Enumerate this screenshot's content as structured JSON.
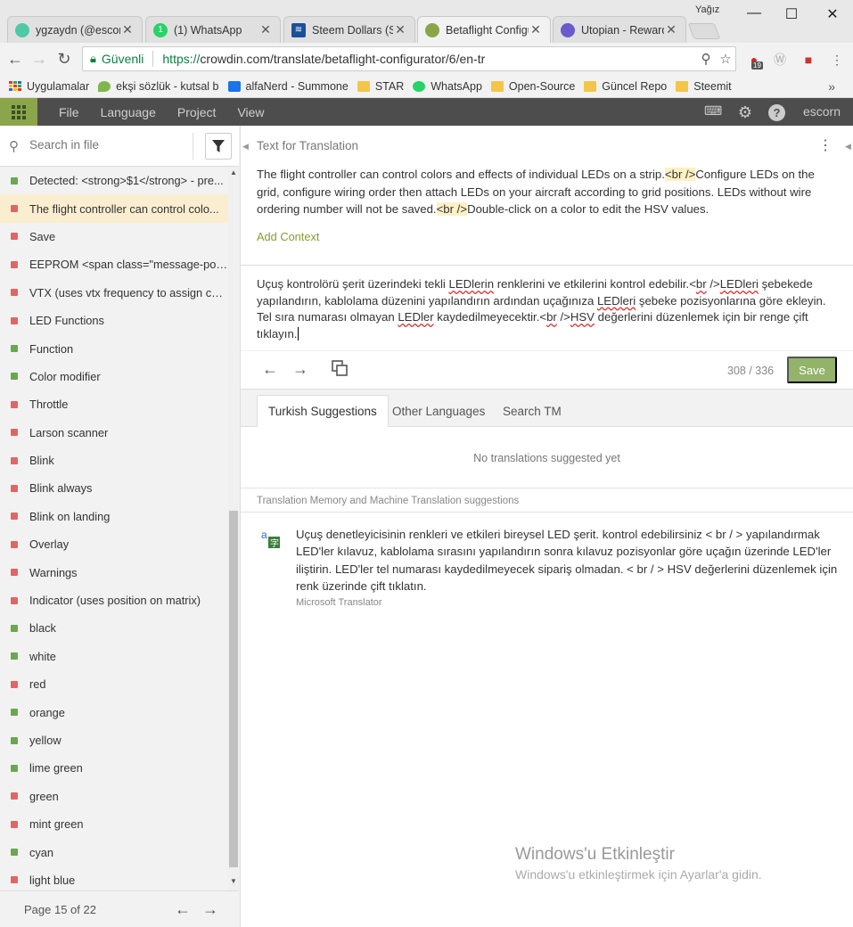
{
  "browser": {
    "profile_name": "Yağız",
    "tabs": [
      {
        "title": "ygzaydn (@escor",
        "icon": "steemit-favicon",
        "color": "#4ec9a8"
      },
      {
        "title": "(1) WhatsApp",
        "icon": "whatsapp-favicon",
        "color": "#25d366"
      },
      {
        "title": "Steem Dollars (SB",
        "icon": "steem-favicon",
        "color": "#1a5099"
      },
      {
        "title": "Betaflight Configu",
        "icon": "crowdin-favicon",
        "color": "#8aa54a"
      },
      {
        "title": "Utopian - Reward",
        "icon": "utopian-favicon",
        "color": "#6a5acd"
      }
    ],
    "address": {
      "secure_label": "Güvenli",
      "url_scheme": "https://",
      "url_rest": "crowdin.com/translate/betaflight-configurator/6/en-tr"
    },
    "extension_badge": "19",
    "bookmarks": [
      {
        "label": "Uygulamalar",
        "icon": "apps-grid-icon"
      },
      {
        "label": "ekşi sözlük - kutsal b",
        "icon": "eksi-drop-icon"
      },
      {
        "label": "alfaNerd - Summone",
        "icon": "alfanerd-icon"
      },
      {
        "label": "STAR",
        "icon": "folder-icon"
      },
      {
        "label": "WhatsApp",
        "icon": "whatsapp-icon"
      },
      {
        "label": "Open-Source",
        "icon": "folder-icon"
      },
      {
        "label": "Güncel Repo",
        "icon": "folder-icon"
      },
      {
        "label": "Steemit",
        "icon": "folder-icon"
      }
    ]
  },
  "app": {
    "menu": [
      "File",
      "Language",
      "Project",
      "View"
    ],
    "user": "escorn",
    "accent": "#8aa54a"
  },
  "sidebar": {
    "search_placeholder": "Search in file",
    "items": [
      {
        "label": "Detected: <strong>$1</strong> - pre...",
        "status": "translated"
      },
      {
        "label": "The flight controller can control colo...",
        "status": "untranslated",
        "selected": true
      },
      {
        "label": "Save",
        "status": "untranslated"
      },
      {
        "label": "EEPROM <span class=\"message-posi...",
        "status": "untranslated"
      },
      {
        "label": "VTX (uses vtx frequency to assign col...",
        "status": "untranslated"
      },
      {
        "label": "LED Functions",
        "status": "untranslated"
      },
      {
        "label": "Function",
        "status": "translated"
      },
      {
        "label": "Color modifier",
        "status": "translated"
      },
      {
        "label": "Throttle",
        "status": "untranslated"
      },
      {
        "label": "Larson scanner",
        "status": "untranslated"
      },
      {
        "label": "Blink",
        "status": "untranslated"
      },
      {
        "label": "Blink always",
        "status": "untranslated"
      },
      {
        "label": "Blink on landing",
        "status": "untranslated"
      },
      {
        "label": "Overlay",
        "status": "untranslated"
      },
      {
        "label": "Warnings",
        "status": "untranslated"
      },
      {
        "label": "Indicator (uses position on matrix)",
        "status": "untranslated"
      },
      {
        "label": "black",
        "status": "translated"
      },
      {
        "label": "white",
        "status": "translated"
      },
      {
        "label": "red",
        "status": "untranslated"
      },
      {
        "label": "orange",
        "status": "translated"
      },
      {
        "label": "yellow",
        "status": "translated"
      },
      {
        "label": "lime green",
        "status": "translated"
      },
      {
        "label": "green",
        "status": "untranslated"
      },
      {
        "label": "mint green",
        "status": "untranslated"
      },
      {
        "label": "cyan",
        "status": "translated"
      },
      {
        "label": "light blue",
        "status": "untranslated"
      }
    ],
    "status_colors": {
      "translated": "#6aa84f",
      "untranslated": "#e06666"
    },
    "pager": "Page 15 of 22"
  },
  "source": {
    "header": "Text for Translation",
    "text_parts": [
      {
        "t": "The flight controller can control colors and effects of individual LEDs on a strip."
      },
      {
        "t": "<br />",
        "tag": true
      },
      {
        "t": "Configure LEDs on the grid, configure wiring order then attach LEDs on your aircraft according to grid positions. LEDs without wire ordering number will not be saved."
      },
      {
        "t": "<br />",
        "tag": true
      },
      {
        "t": "Double-click on a color to edit the HSV values."
      }
    ],
    "add_context": "Add Context"
  },
  "translation": {
    "text_parts": [
      {
        "t": "Uçuş kontrolörü şerit üzerindeki tekli "
      },
      {
        "t": "LEDlerin",
        "sq": true
      },
      {
        "t": " renklerini ve etkilerini kontrol edebilir.<"
      },
      {
        "t": "br",
        "sq": true
      },
      {
        "t": " />"
      },
      {
        "t": "LEDleri",
        "sq": true
      },
      {
        "t": " şebekede yapılandırın, kablolama düzenini yapılandırın ardından uçağınıza "
      },
      {
        "t": "LEDleri",
        "sq": true
      },
      {
        "t": " şebeke pozisyonlarına göre ekleyin. Tel sıra numarası olmayan "
      },
      {
        "t": "LEDler",
        "sq": true
      },
      {
        "t": " kaydedilmeyecektir.<"
      },
      {
        "t": "br",
        "sq": true
      },
      {
        "t": " />"
      },
      {
        "t": "HSV",
        "sq": true
      },
      {
        "t": " değerlerini düzenlemek için bir renge çift tıklayın."
      }
    ],
    "counter": "308 / 336",
    "save_label": "Save"
  },
  "suggestions": {
    "tabs": [
      "Turkish Suggestions",
      "Other Languages",
      "Search TM"
    ],
    "empty_message": "No translations suggested yet",
    "tm_header": "Translation Memory and Machine Translation suggestions",
    "mt_text": "Uçuş denetleyicisinin renkleri ve etkileri bireysel LED şerit. kontrol edebilirsiniz < br / > yapılandırmak LED'ler kılavuz, kablolama sırasını yapılandırın sonra kılavuz pozisyonlar göre uçağın üzerinde LED'ler iliştirin. LED'ler tel numarası kaydedilmeyecek sipariş olmadan. < br / > HSV değerlerini düzenlemek için renk üzerinde çift tıklatın.",
    "mt_source": "Microsoft Translator"
  },
  "watermark": {
    "title": "Windows'u Etkinleştir",
    "subtitle": "Windows'u etkinleştirmek için Ayarlar'a gidin."
  }
}
